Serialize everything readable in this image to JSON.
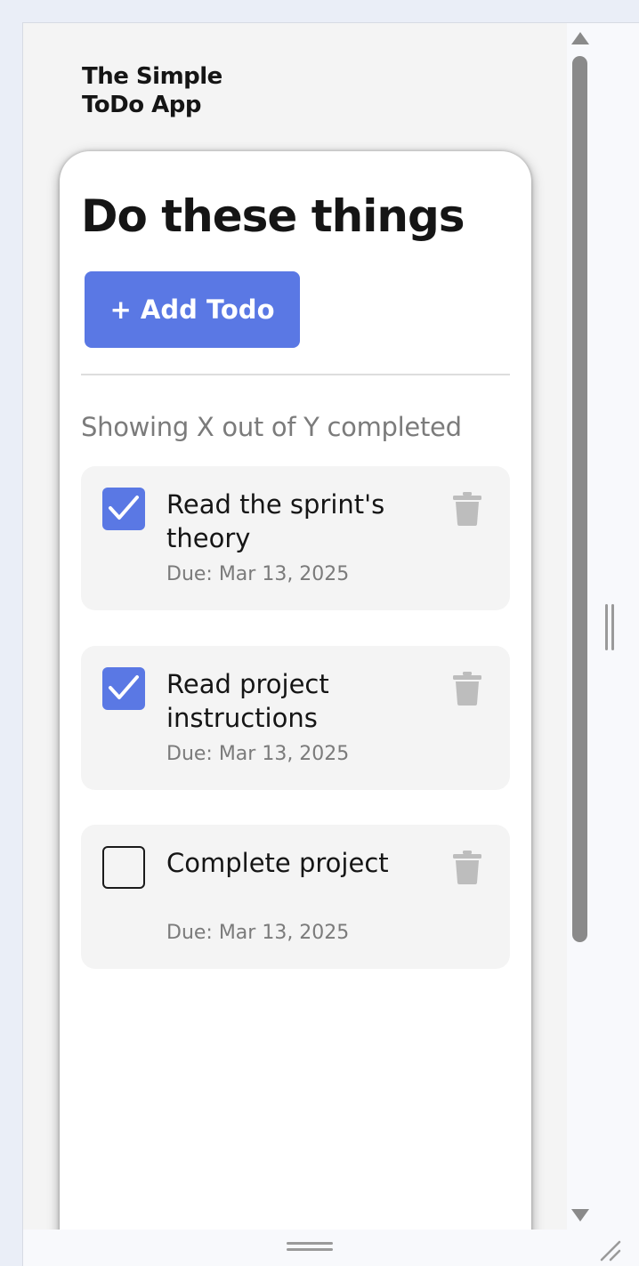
{
  "app": {
    "title": "The Simple ToDo App"
  },
  "card": {
    "heading": "Do these things",
    "add_button_label": "+ Add Todo",
    "summary": "Showing X out of Y completed"
  },
  "todos": [
    {
      "text": "Read the sprint's theory",
      "due": "Due: Mar 13, 2025",
      "completed": true
    },
    {
      "text": "Read project instructions",
      "due": "Due: Mar 13, 2025",
      "completed": true
    },
    {
      "text": "Complete project",
      "due": "Due: Mar 13, 2025",
      "completed": false
    }
  ],
  "colors": {
    "accent": "#5a78e4",
    "card_bg": "#ffffff",
    "page_bg": "#f4f4f4",
    "muted_text": "#7b7b7b",
    "trash_icon": "#bdbdbd"
  },
  "icons": {
    "checkbox_checked": "check-icon",
    "delete": "trash-icon",
    "scroll_up": "scroll-up-arrow-icon",
    "scroll_down": "scroll-down-arrow-icon",
    "resize": "resize-grip-icon"
  }
}
